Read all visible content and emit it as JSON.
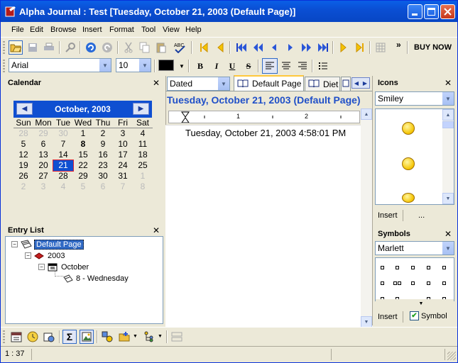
{
  "window": {
    "title": "Alpha Journal : Test [Tuesday, October 21, 2003 (Default Page)]"
  },
  "menu": [
    "File",
    "Edit",
    "Browse",
    "Insert",
    "Format",
    "Tool",
    "View",
    "Help"
  ],
  "toolbar": {
    "buy_now": "BUY NOW",
    "overflow": "»"
  },
  "format_bar": {
    "font": "Arial",
    "size": "10",
    "bold": "B",
    "italic": "I",
    "underline": "U",
    "strike": "S"
  },
  "calendar": {
    "panel_title": "Calendar",
    "month_label": "October, 2003",
    "weekdays": [
      "Sun",
      "Mon",
      "Tue",
      "Wed",
      "Thu",
      "Fri",
      "Sat"
    ],
    "days": [
      [
        "28",
        "29",
        "30",
        "1",
        "2",
        "3",
        "4"
      ],
      [
        "5",
        "6",
        "7",
        "8",
        "9",
        "10",
        "11"
      ],
      [
        "12",
        "13",
        "14",
        "15",
        "16",
        "17",
        "18"
      ],
      [
        "19",
        "20",
        "21",
        "22",
        "23",
        "24",
        "25"
      ],
      [
        "26",
        "27",
        "28",
        "29",
        "30",
        "31",
        "1"
      ],
      [
        "2",
        "3",
        "4",
        "5",
        "6",
        "7",
        "8"
      ]
    ],
    "selected": "21",
    "bold_day": "8"
  },
  "entry_list": {
    "panel_title": "Entry List",
    "items": [
      {
        "label": "Default Page",
        "level": 0,
        "expander": "−"
      },
      {
        "label": "2003",
        "level": 1,
        "expander": "−"
      },
      {
        "label": "October",
        "level": 2,
        "expander": "−"
      },
      {
        "label": "8 - Wednesday",
        "level": 3,
        "expander": ""
      }
    ]
  },
  "center": {
    "view_select": "Dated",
    "tabs": [
      "Default Page",
      "Diet"
    ],
    "page_title": "Tuesday, October 21, 2003 (Default Page)",
    "ruler_marks": [
      "1",
      "2"
    ],
    "entry_line": "Tuesday, October 21, 2003 4:58:01 PM"
  },
  "icons_panel": {
    "panel_title": "Icons",
    "category": "Smiley",
    "insert_label": "Insert",
    "more_label": "..."
  },
  "symbols_panel": {
    "panel_title": "Symbols",
    "font": "Marlett",
    "insert_label": "Insert",
    "symbol_label": "Symbol",
    "symbol_checked": true
  },
  "statusbar": {
    "position": "1 : 37"
  }
}
